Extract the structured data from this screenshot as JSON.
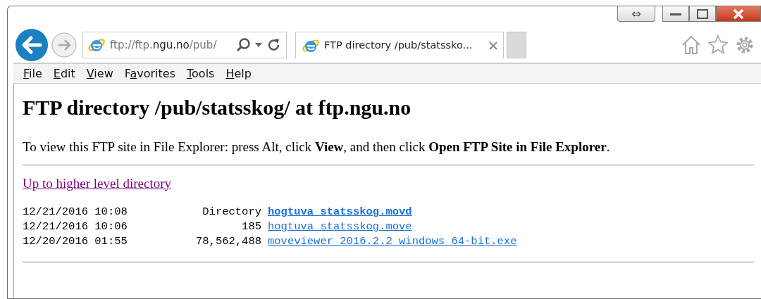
{
  "window": {
    "caption_buttons": [
      "⇔"
    ]
  },
  "address": {
    "parts": [
      {
        "text": "ftp://ftp.",
        "strong": false
      },
      {
        "text": "ngu.no",
        "strong": true
      },
      {
        "text": "/pub/",
        "strong": false
      }
    ]
  },
  "tabs": [
    {
      "title": "FTP directory /pub/statssko...",
      "selected": true
    }
  ],
  "menu": [
    {
      "access_key": "F",
      "rest": "ile"
    },
    {
      "access_key": "E",
      "rest": "dit"
    },
    {
      "access_key": "V",
      "rest": "iew"
    },
    {
      "lead": "F",
      "access_key": "a",
      "rest": "vorites"
    },
    {
      "access_key": "T",
      "rest": "ools"
    },
    {
      "access_key": "H",
      "rest": "elp"
    }
  ],
  "page": {
    "heading": "FTP directory /pub/statsskog/ at ftp.ngu.no",
    "note": "To view this FTP site in File Explorer: press Alt, click **View**, and then click **Open FTP Site in File Explorer**.",
    "up_link": "Up to higher level directory",
    "entries": [
      {
        "date": "12/21/2016 10:08",
        "size": "Directory",
        "name": "hogtuva_statsskog.movd",
        "kind": "directory"
      },
      {
        "date": "12/21/2016 10:06",
        "size": "185",
        "name": "hogtuva_statsskog.move",
        "kind": "file"
      },
      {
        "date": "12/20/2016 01:55",
        "size": "78,562,488",
        "name": "moveviewer_2016.2.2_windows_64-bit.exe",
        "kind": "file"
      }
    ]
  }
}
